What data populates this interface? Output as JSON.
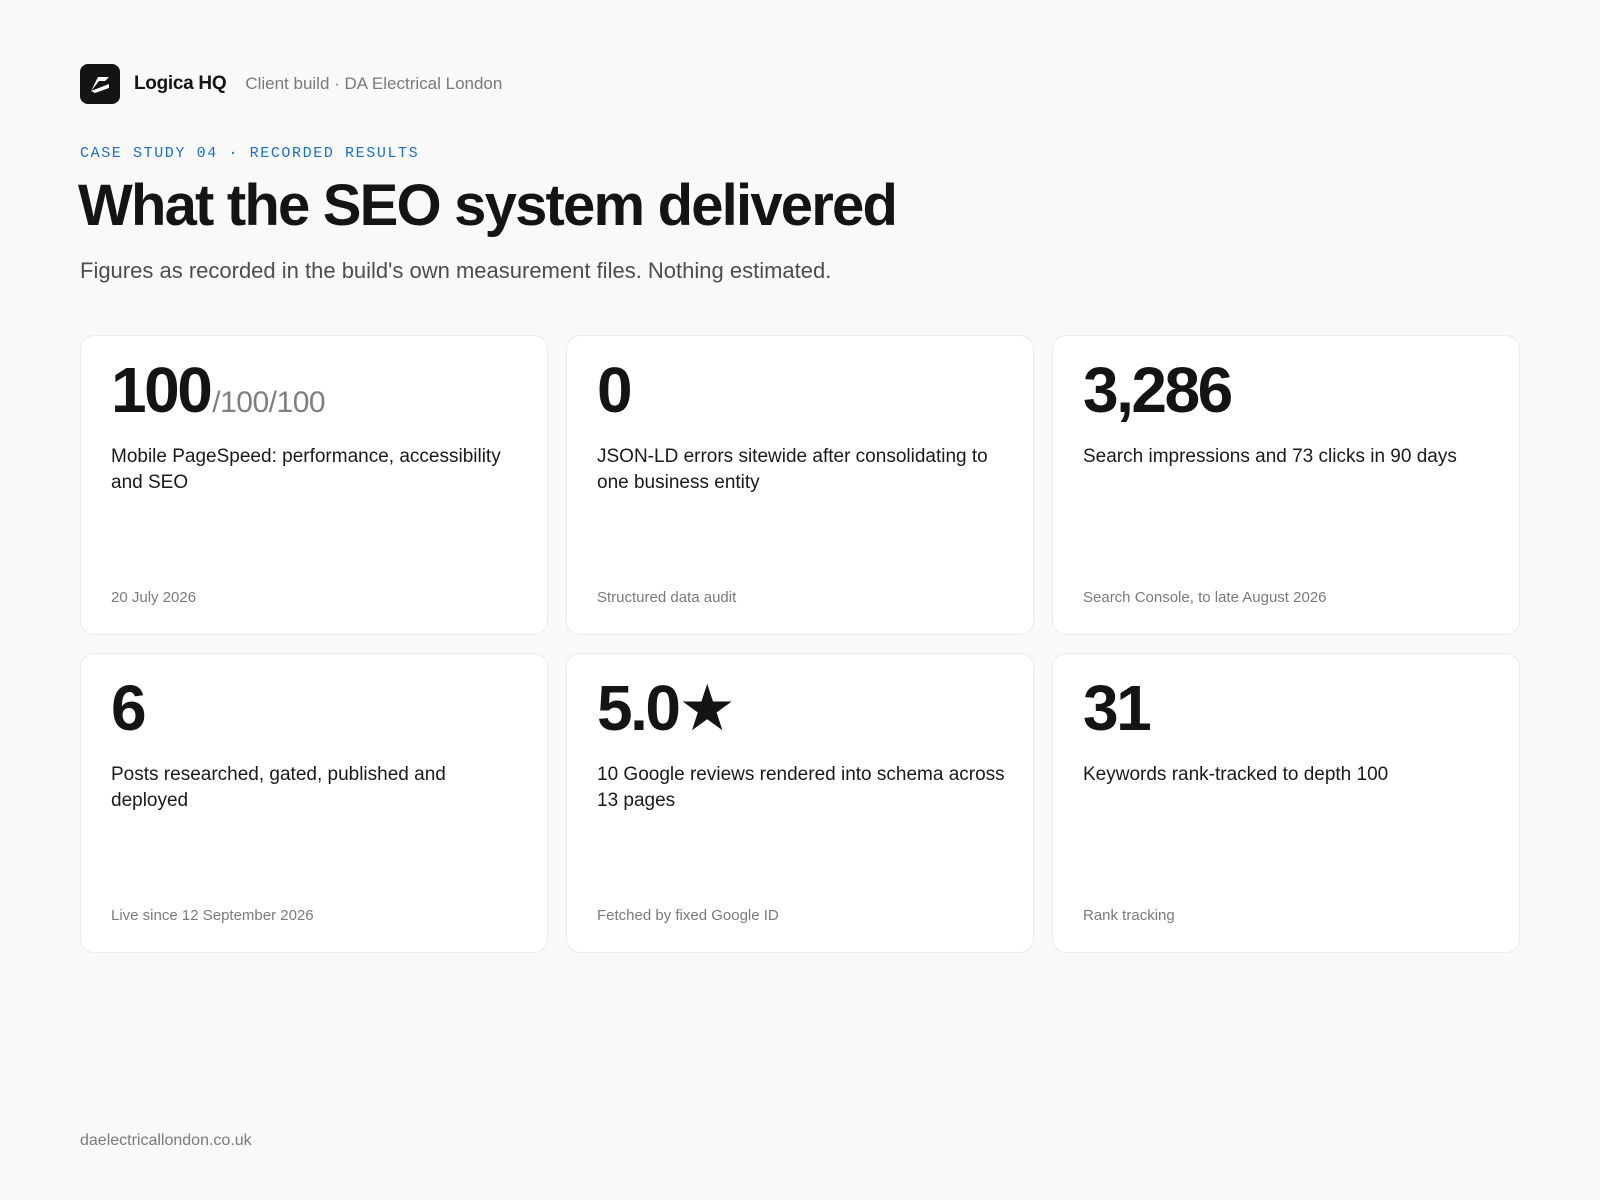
{
  "header": {
    "brand": "Logica HQ",
    "client_line": "Client build · DA Electrical London",
    "logo_icon": "logica-slash-logo"
  },
  "eyebrow": "CASE STUDY 04 · RECORDED RESULTS",
  "title": "What the SEO system delivered",
  "subtitle": "Figures as recorded in the build's own measurement files. Nothing estimated.",
  "cards": [
    {
      "stat": "100",
      "stat_suffix": "/100/100",
      "description": "Mobile PageSpeed: performance, accessibility and SEO",
      "source": "20 July 2026"
    },
    {
      "stat": "0",
      "stat_suffix": "",
      "description": "JSON-LD errors sitewide after consolidating to one business entity",
      "source": "Structured data audit"
    },
    {
      "stat": "3,286",
      "stat_suffix": "",
      "description": "Search impressions and 73 clicks in 90 days",
      "source": "Search Console, to late August 2026"
    },
    {
      "stat": "6",
      "stat_suffix": "",
      "description": "Posts researched, gated, published and deployed",
      "source": "Live since 12 September 2026"
    },
    {
      "stat": "5.0★",
      "stat_suffix": "",
      "description": "10 Google reviews rendered into schema across 13 pages",
      "source": "Fetched by fixed Google ID"
    },
    {
      "stat": "31",
      "stat_suffix": "",
      "description": "Keywords rank-tracked to depth 100",
      "source": "Rank tracking"
    }
  ],
  "footer": "daelectricallondon.co.uk",
  "colors": {
    "accent": "#1a6fc9",
    "background": "#f9f9f9",
    "card": "#ffffff",
    "ink": "#141414",
    "muted": "#7a7a7a"
  }
}
